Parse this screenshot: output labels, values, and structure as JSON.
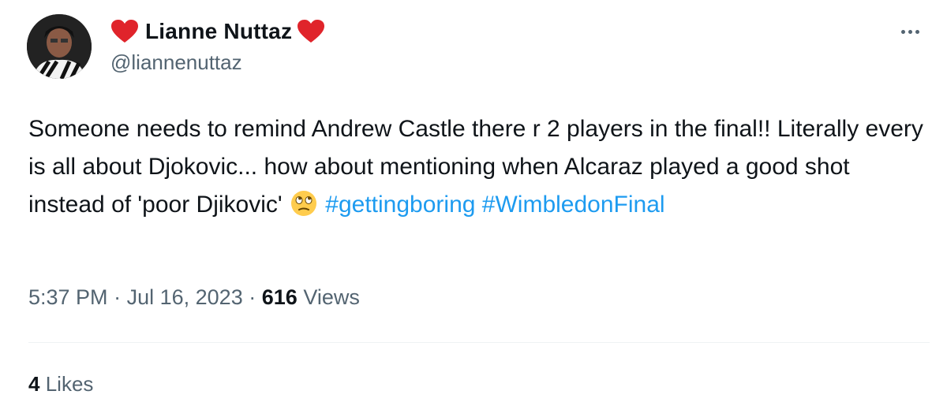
{
  "author": {
    "display_name": "Lianne Nuttaz",
    "handle": "@liannenuttaz",
    "name_decoration_icon": "red-heart-emoji"
  },
  "more_icon": "more-horizontal-icon",
  "tweet": {
    "text_part1": "Someone needs to remind Andrew Castle there r 2 players in the final!! Literally every is all about  Djokovic... how about mentioning when Alcaraz played a good shot instead of 'poor Djikovic' ",
    "emoji": "rolling-eyes-face-emoji",
    "hashtags": [
      "#gettingboring",
      "#WimbledonFinal"
    ]
  },
  "meta": {
    "time": "5:37 PM",
    "separator": "·",
    "date": "Jul 16, 2023",
    "views_count": "616",
    "views_label": "Views"
  },
  "stats": {
    "likes_count": "4",
    "likes_label": "Likes"
  },
  "colors": {
    "link": "#1d9bf0",
    "secondary_text": "#536471",
    "primary_text": "#0f1419",
    "heart": "#e0242b"
  }
}
